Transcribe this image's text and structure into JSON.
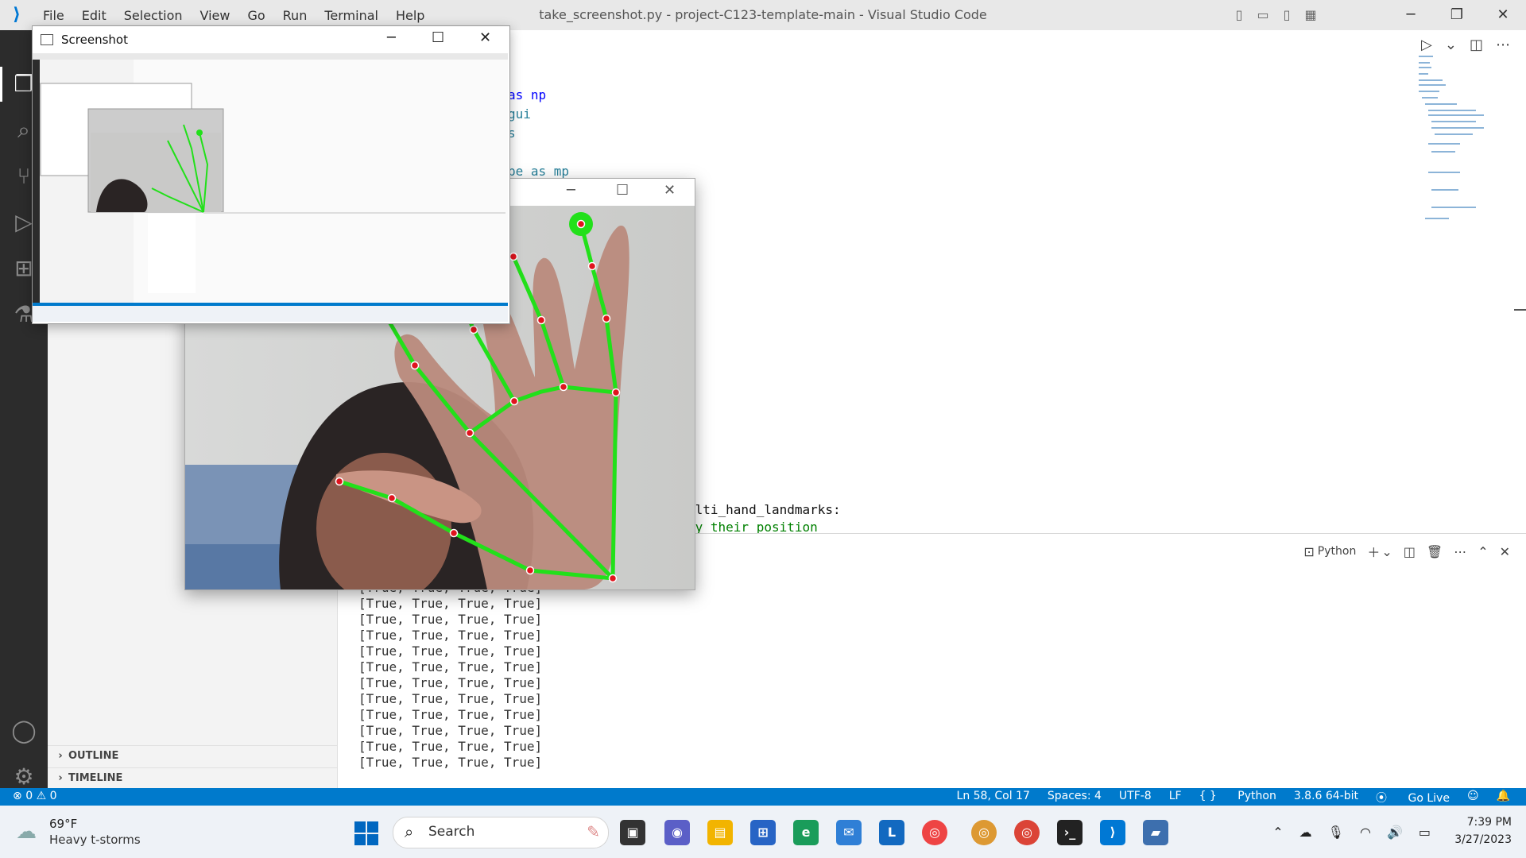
{
  "window": {
    "title": "take_screenshot.py - project-C123-template-main - Visual Studio Code"
  },
  "menu": [
    "File",
    "Edit",
    "Selection",
    "View",
    "Go",
    "Run",
    "Terminal",
    "Help"
  ],
  "code_fragments": [
    {
      "text": "as np",
      "kw": "as"
    },
    {
      "text": "gui",
      "kw": ""
    },
    {
      "text": "s",
      "kw": ""
    },
    {
      "text": "pe as mp",
      "kw": "as"
    },
    {
      "text": "ulti_hand_landmarks:",
      "kw": ""
    },
    {
      "text": "by their position",
      "kw": ""
    }
  ],
  "sidebar": {
    "outline_label": "OUTLINE",
    "timeline_label": "TIMELINE"
  },
  "panel": {
    "terminal_profile": "Python"
  },
  "terminal_lines": [
    "[True, True, True, True]",
    "[True, True, True, True]",
    "[True, True, True, True]",
    "[True, True, True, True]",
    "[True, True, True, True]",
    "[True, True, True, True]",
    "[True, True, True, True]",
    "[True, True, True, True]",
    "[True, True, True, True]",
    "[True, True, True, True]",
    "[True, True, True, True]",
    "[True, True, True, True]"
  ],
  "statusbar": {
    "errors": "0",
    "warnings": "0",
    "position": "Ln 58, Col 17",
    "spaces": "Spaces: 4",
    "encoding": "UTF-8",
    "eol": "LF",
    "language": "Python",
    "interpreter": "3.8.6 64-bit",
    "golive": "Go Live"
  },
  "screenshot_window": {
    "title": "Screenshot"
  },
  "taskbar": {
    "temp": "69°F",
    "weather": "Heavy t-storms",
    "search": "Search",
    "time": "7:39 PM",
    "date": "3/27/2023"
  },
  "colors": {
    "accent": "#007acc",
    "hand_line": "#22e01a",
    "landmark": "#e0141e"
  }
}
